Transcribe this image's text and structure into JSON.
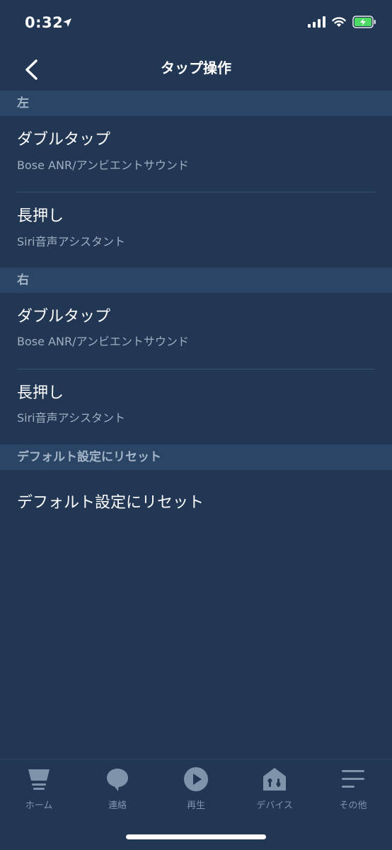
{
  "status_bar": {
    "time": "0:32"
  },
  "nav": {
    "title": "タップ操作"
  },
  "sections": [
    {
      "header": "左",
      "items": [
        {
          "title": "ダブルタップ",
          "subtitle": "Bose ANR/アンビエントサウンド"
        },
        {
          "title": "長押し",
          "subtitle": "Siri音声アシスタント"
        }
      ]
    },
    {
      "header": "右",
      "items": [
        {
          "title": "ダブルタップ",
          "subtitle": "Bose ANR/アンビエントサウンド"
        },
        {
          "title": "長押し",
          "subtitle": "Siri音声アシスタント"
        }
      ]
    },
    {
      "header": "デフォルト設定にリセット",
      "items": [
        {
          "title": "デフォルト設定にリセット"
        }
      ]
    }
  ],
  "tab_bar": {
    "tabs": [
      {
        "label": "ホーム",
        "icon": "home-icon"
      },
      {
        "label": "連絡",
        "icon": "chat-bubble-icon"
      },
      {
        "label": "再生",
        "icon": "play-icon"
      },
      {
        "label": "デバイス",
        "icon": "devices-icon"
      },
      {
        "label": "その他",
        "icon": "menu-icon"
      }
    ]
  },
  "colors": {
    "background": "#223753",
    "section_header_bg": "#2a4566",
    "section_header_text": "#a4b5c7",
    "subtitle_text": "#9fb0c2",
    "tab_inactive": "#7f93ab",
    "battery_charge": "#4cd964"
  }
}
